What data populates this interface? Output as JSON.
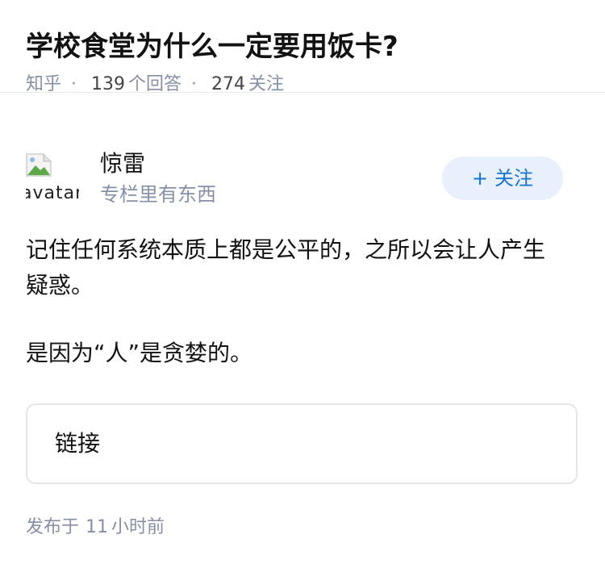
{
  "question": {
    "title": "学校食堂为什么一定要用饭卡?"
  },
  "meta": {
    "source": "知乎",
    "answer_count": "139",
    "answer_label": "个回答",
    "follower_count": "274",
    "follower_label": "关注",
    "separator": "·"
  },
  "author": {
    "name": "惊雷",
    "bio": "专栏里有东西",
    "avatar_alt": "avatar",
    "follow_plus": "+",
    "follow_label": "关注"
  },
  "answer": {
    "paragraphs": [
      "记住任何系统本质上都是公平的，之所以会让人产生疑惑。",
      "是因为“人”是贪婪的。"
    ]
  },
  "link_card": {
    "label": "链接"
  },
  "footer": {
    "prefix": "发布于",
    "time_value": "11",
    "time_unit": "小时前"
  },
  "colors": {
    "accent": "#1772d4",
    "follow_bg": "#e8f1fb",
    "muted": "#8590a6",
    "text": "#121212",
    "border": "#e6e6e6"
  },
  "icons": {
    "avatar": "broken-image-icon"
  }
}
